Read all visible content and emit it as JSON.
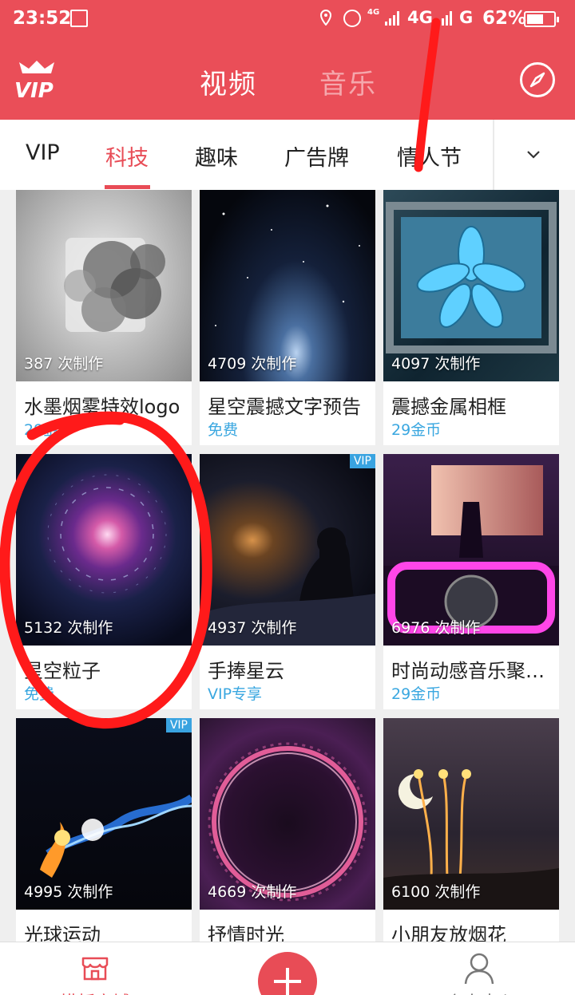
{
  "status_bar": {
    "time": "23:52",
    "network_small": "4G",
    "network_1": "4G",
    "network_2": "G",
    "battery": "62%",
    "battery_level": 0.62
  },
  "header": {
    "tabs": [
      {
        "label": "视频",
        "active": true
      },
      {
        "label": "音乐",
        "active": false
      }
    ],
    "icons": [
      "vip-crown-icon",
      "compass-icon"
    ]
  },
  "categories": [
    "VIP",
    "科技",
    "趣味",
    "广告牌",
    "情人节"
  ],
  "active_category": "科技",
  "cards": [
    {
      "count": "387 次制作",
      "title": "水墨烟雾特效logo",
      "price": "29金币",
      "vip": false
    },
    {
      "count": "4709 次制作",
      "title": "星空震撼文字预告",
      "price": "免费",
      "vip": false
    },
    {
      "count": "4097 次制作",
      "title": "震撼金属相框",
      "price": "29金币",
      "vip": false
    },
    {
      "count": "5132 次制作",
      "title": "星空粒子",
      "price": "免费",
      "vip": false
    },
    {
      "count": "4937 次制作",
      "title": "手捧星云",
      "price": "VIP专享",
      "vip": true
    },
    {
      "count": "6976 次制作",
      "title": "时尚动感音乐聚…",
      "price": "29金币",
      "vip": false
    },
    {
      "count": "4995 次制作",
      "title": "光球运动",
      "price": "",
      "vip": true
    },
    {
      "count": "4669 次制作",
      "title": "抒情时光",
      "price": "",
      "vip": false
    },
    {
      "count": "6100 次制作",
      "title": "小朋友放烟花",
      "price": "",
      "vip": false
    }
  ],
  "vip_badge": "VIP",
  "bottom_nav": {
    "left_label": "模板商城",
    "right_label": "个人中心"
  },
  "colors": {
    "brand_red": "#ea4e58",
    "price_blue": "#3aa7e0",
    "annotation_red": "#ff1a1a"
  }
}
